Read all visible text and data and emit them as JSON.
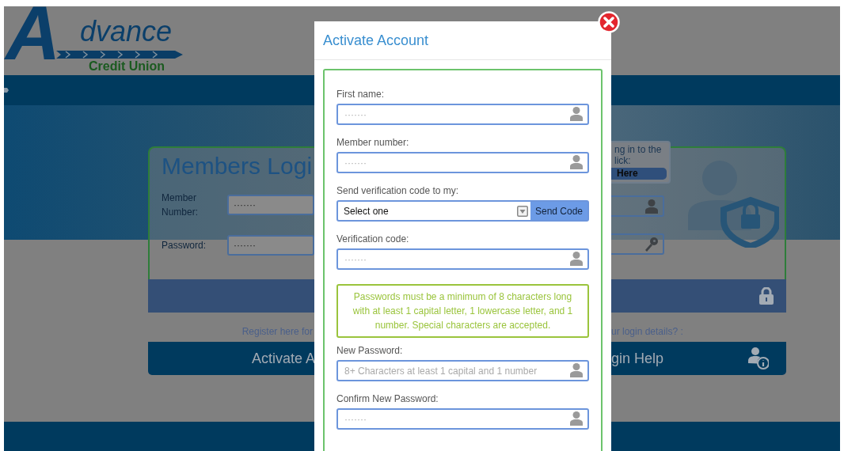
{
  "logo": {
    "initial": "A",
    "wordmark": "dvance",
    "tagline": "Credit Union"
  },
  "login_card": {
    "title": "Members Logi",
    "fields": [
      {
        "label": "Member Number:",
        "placeholder": "·······"
      },
      {
        "label": "Password:",
        "placeholder": "·······"
      }
    ],
    "tooltip": {
      "lines": [
        "ng in to the",
        "lick:"
      ],
      "link": "Here"
    }
  },
  "register_prompt": "Register here for",
  "help_prompt": "ur login details? :",
  "activate_button": "Activate A",
  "help_button": "gin Help",
  "modal": {
    "title": "Activate Account",
    "fields": [
      {
        "kind": "text",
        "label": "First name:",
        "placeholder": "·······"
      },
      {
        "kind": "text",
        "label": "Member number:",
        "placeholder": "·······"
      },
      {
        "kind": "select",
        "label": "Send verification code to my:",
        "value": "Select one",
        "button": "Send Code"
      },
      {
        "kind": "text",
        "label": "Verification code:",
        "placeholder": "·······"
      },
      {
        "kind": "notice",
        "text": "Passwords must be a minimum of 8 characters long with at least 1 capital letter, 1 lowercase letter, and 1 number. Special characters are accepted."
      },
      {
        "kind": "text",
        "label": "New Password:",
        "placeholder": "8+ Characters at least 1 capital and 1 number"
      },
      {
        "kind": "text",
        "label": "Confirm New Password:",
        "placeholder": "·······"
      }
    ]
  }
}
